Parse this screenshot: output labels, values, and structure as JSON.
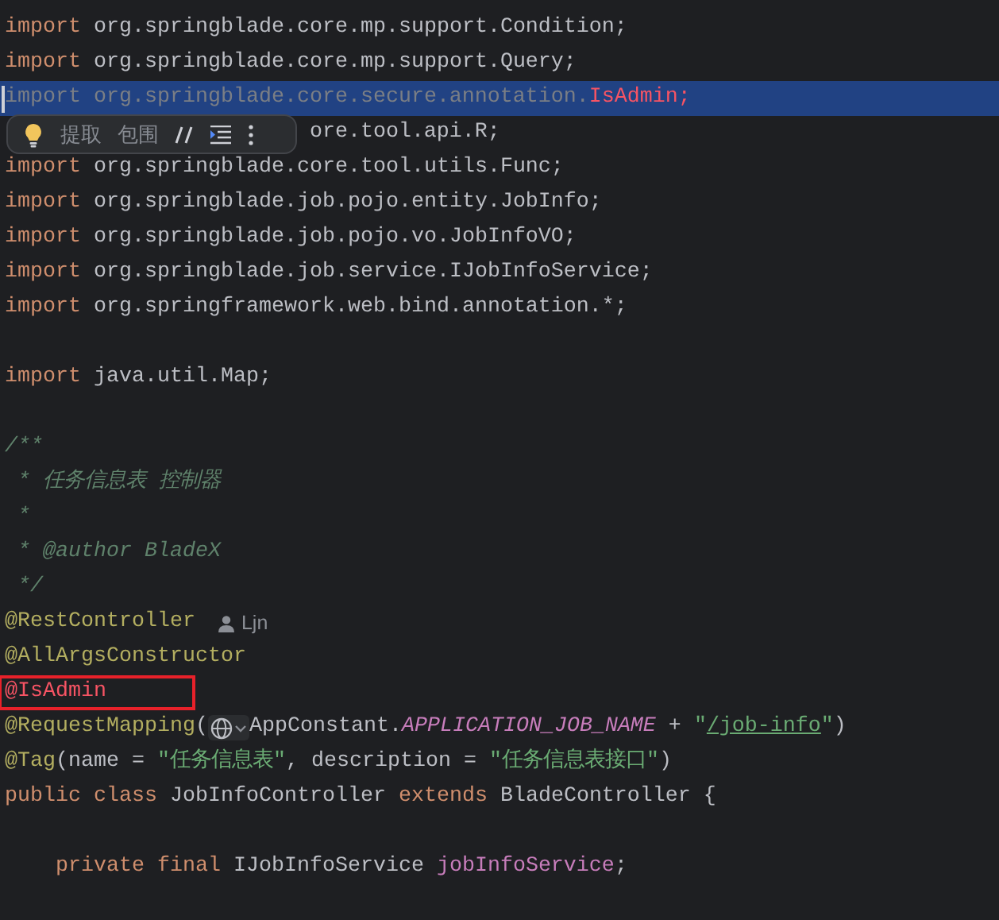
{
  "popup": {
    "items": [
      {
        "kind": "bulb"
      },
      {
        "kind": "text",
        "text": "提取"
      },
      {
        "kind": "text",
        "text": "包围"
      },
      {
        "kind": "comment"
      },
      {
        "kind": "format"
      },
      {
        "kind": "more"
      }
    ]
  },
  "lines": [
    {
      "kind": "code",
      "tokens": [
        {
          "kind": "keyword",
          "text": "import"
        },
        {
          "kind": "plain",
          "text": " org.springblade.core.mp.support.Condition;"
        }
      ]
    },
    {
      "kind": "code",
      "tokens": [
        {
          "kind": "keyword",
          "text": "import"
        },
        {
          "kind": "plain",
          "text": " org.springblade.core.mp.support.Query;"
        }
      ]
    },
    {
      "kind": "code",
      "selected": true,
      "caret": true,
      "tokens": [
        {
          "kind": "unused",
          "text": "import org.springblade.core.secure.annotation."
        },
        {
          "kind": "error",
          "text": "IsAdmin;"
        }
      ]
    },
    {
      "kind": "partial",
      "tokens": [
        {
          "kind": "plain",
          "text": "ore.tool.api.R;"
        }
      ]
    },
    {
      "kind": "code",
      "tokens": [
        {
          "kind": "keyword",
          "text": "import"
        },
        {
          "kind": "plain",
          "text": " org.springblade.core.tool.utils.Func;"
        }
      ]
    },
    {
      "kind": "code",
      "tokens": [
        {
          "kind": "keyword",
          "text": "import"
        },
        {
          "kind": "plain",
          "text": " org.springblade.job.pojo.entity.JobInfo;"
        }
      ]
    },
    {
      "kind": "code",
      "tokens": [
        {
          "kind": "keyword",
          "text": "import"
        },
        {
          "kind": "plain",
          "text": " org.springblade.job.pojo.vo.JobInfoVO;"
        }
      ]
    },
    {
      "kind": "code",
      "tokens": [
        {
          "kind": "keyword",
          "text": "import"
        },
        {
          "kind": "plain",
          "text": " org.springblade.job.service.IJobInfoService;"
        }
      ]
    },
    {
      "kind": "code",
      "tokens": [
        {
          "kind": "keyword",
          "text": "import"
        },
        {
          "kind": "plain",
          "text": " org.springframework.web.bind.annotation.*;"
        }
      ]
    },
    {
      "kind": "blank"
    },
    {
      "kind": "code",
      "tokens": [
        {
          "kind": "keyword",
          "text": "import"
        },
        {
          "kind": "plain",
          "text": " java.util.Map;"
        }
      ]
    },
    {
      "kind": "blank"
    },
    {
      "kind": "code",
      "tokens": [
        {
          "kind": "doc",
          "text": "/**"
        }
      ]
    },
    {
      "kind": "code",
      "tokens": [
        {
          "kind": "doc",
          "text": " * 任务信息表 控制器"
        }
      ]
    },
    {
      "kind": "code",
      "tokens": [
        {
          "kind": "doc",
          "text": " *"
        }
      ]
    },
    {
      "kind": "code",
      "tokens": [
        {
          "kind": "doc",
          "text": " * "
        },
        {
          "kind": "doc-tag",
          "text": "@author"
        },
        {
          "kind": "doc",
          "text": " BladeX"
        }
      ]
    },
    {
      "kind": "code",
      "tokens": [
        {
          "kind": "doc",
          "text": " */"
        }
      ]
    },
    {
      "kind": "code",
      "tokens": [
        {
          "kind": "annotation",
          "text": "@RestController"
        },
        {
          "kind": "author-hint",
          "text": "Ljn"
        }
      ]
    },
    {
      "kind": "code",
      "tokens": [
        {
          "kind": "annotation",
          "text": "@AllArgsConstructor"
        }
      ]
    },
    {
      "kind": "code",
      "boxed": true,
      "tokens": [
        {
          "kind": "error",
          "text": "@IsAdmin"
        }
      ]
    },
    {
      "kind": "code",
      "tokens": [
        {
          "kind": "annotation",
          "text": "@RequestMapping"
        },
        {
          "kind": "plain",
          "text": "("
        },
        {
          "kind": "url-inlay"
        },
        {
          "kind": "plain",
          "text": "AppConstant."
        },
        {
          "kind": "constant",
          "text": "APPLICATION_JOB_NAME"
        },
        {
          "kind": "plain",
          "text": " + "
        },
        {
          "kind": "string",
          "text": "\""
        },
        {
          "kind": "link-string",
          "text": "/job-info"
        },
        {
          "kind": "string",
          "text": "\""
        },
        {
          "kind": "plain",
          "text": ")"
        }
      ]
    },
    {
      "kind": "code",
      "tokens": [
        {
          "kind": "annotation",
          "text": "@Tag"
        },
        {
          "kind": "plain",
          "text": "(name = "
        },
        {
          "kind": "string",
          "text": "\"任务信息表\""
        },
        {
          "kind": "plain",
          "text": ", description = "
        },
        {
          "kind": "string",
          "text": "\"任务信息表接口\""
        },
        {
          "kind": "plain",
          "text": ")"
        }
      ]
    },
    {
      "kind": "code",
      "tokens": [
        {
          "kind": "keyword",
          "text": "public class"
        },
        {
          "kind": "plain",
          "text": " JobInfoController "
        },
        {
          "kind": "keyword",
          "text": "extends"
        },
        {
          "kind": "plain",
          "text": " BladeController {"
        }
      ]
    },
    {
      "kind": "blank"
    },
    {
      "kind": "indented",
      "tokens": [
        {
          "kind": "keyword",
          "text": "private final"
        },
        {
          "kind": "plain",
          "text": " IJobInfoService "
        },
        {
          "kind": "field",
          "text": "jobInfoService"
        },
        {
          "kind": "plain",
          "text": ";"
        }
      ]
    }
  ]
}
